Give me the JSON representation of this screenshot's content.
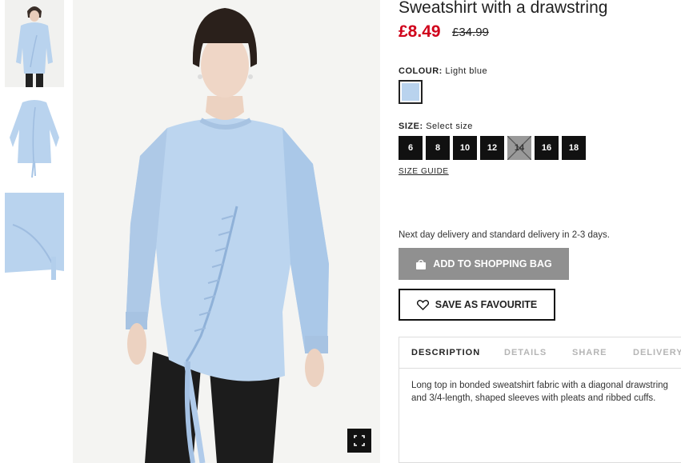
{
  "product": {
    "title": "Sweatshirt with a drawstring",
    "price_current": "£8.49",
    "price_original": "£34.99"
  },
  "colour": {
    "label": "COLOUR:",
    "value": "Light blue",
    "swatch_color": "#b9d3ee"
  },
  "size": {
    "label": "SIZE:",
    "prompt": "Select size",
    "options": [
      {
        "label": "6",
        "available": true
      },
      {
        "label": "8",
        "available": true
      },
      {
        "label": "10",
        "available": true
      },
      {
        "label": "12",
        "available": true
      },
      {
        "label": "14",
        "available": false
      },
      {
        "label": "16",
        "available": true
      },
      {
        "label": "18",
        "available": true
      }
    ],
    "guide_link": "SIZE GUIDE"
  },
  "delivery_text": "Next day delivery and standard delivery in 2-3 days.",
  "buttons": {
    "add_to_bag": "ADD TO SHOPPING BAG",
    "save_favourite": "SAVE AS FAVOURITE"
  },
  "tabs": {
    "items": [
      "DESCRIPTION",
      "DETAILS",
      "SHARE",
      "DELIVERY"
    ],
    "active": "DESCRIPTION"
  },
  "description": "Long top in bonded sweatshirt fabric with a diagonal drawstring and 3/4-length, shaped sleeves with pleats and ribbed cuffs.",
  "icons": {
    "bag": "shopping-bag-icon",
    "favourite": "heart-icon",
    "expand": "expand-icon"
  },
  "colors": {
    "price_red": "#d0021b",
    "button_grey": "#909090",
    "garment_blue": "#b9d3ee"
  }
}
